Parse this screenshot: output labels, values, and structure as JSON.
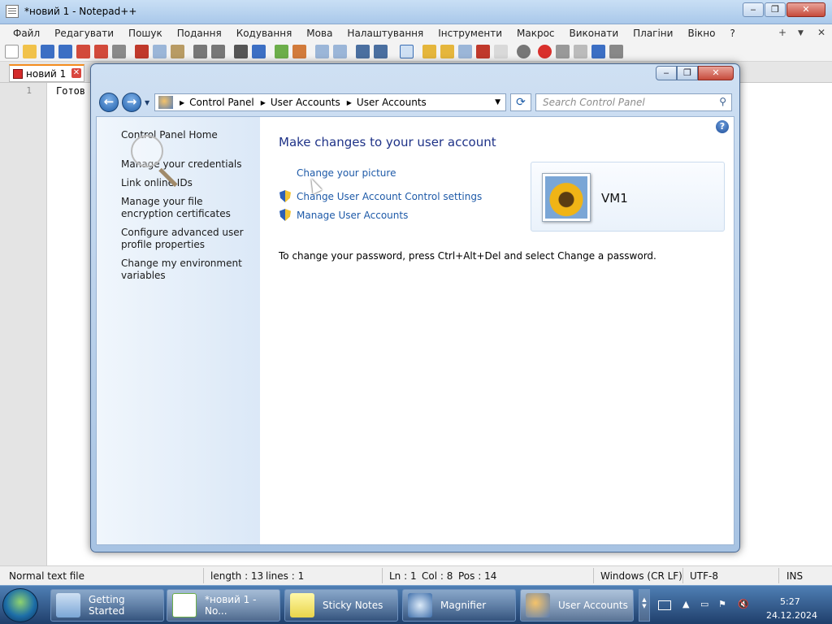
{
  "npp": {
    "title": "*новий 1 - Notepad++",
    "menu": [
      "Файл",
      "Редагувати",
      "Пошук",
      "Подання",
      "Кодування",
      "Мова",
      "Налаштування",
      "Інструменти",
      "Макрос",
      "Виконати",
      "Плагіни",
      "Вікно",
      "?"
    ],
    "menu_right": [
      "+",
      "▼",
      "✕"
    ],
    "tab_label": "новий 1",
    "line_number": "1",
    "editor_text": "Готов",
    "status": {
      "file_type": "Normal text file",
      "length": "length : 13",
      "lines": "lines : 1",
      "ln": "Ln : 1",
      "col": "Col : 8",
      "pos": "Pos : 14",
      "eol": "Windows (CR LF)",
      "encoding": "UTF-8",
      "mode": "INS"
    }
  },
  "cp": {
    "breadcrumb": [
      "Control Panel",
      "User Accounts",
      "User Accounts"
    ],
    "search_placeholder": "Search Control Panel",
    "left_links": [
      "Control Panel Home",
      "Manage your credentials",
      "Link online IDs",
      "Manage your file encryption certificates",
      "Configure advanced user profile properties",
      "Change my environment variables"
    ],
    "heading": "Make changes to your user account",
    "links": [
      "Change your picture",
      "Change User Account Control settings",
      "Manage User Accounts"
    ],
    "password_note": "To change your password, press Ctrl+Alt+Del and select Change a password.",
    "username": "VM1"
  },
  "taskbar": {
    "items": [
      "Getting Started",
      "*новий 1 - No...",
      "Sticky Notes",
      "Magnifier",
      "User Accounts"
    ],
    "time": "5:27",
    "date": "24.12.2024"
  },
  "colors": {
    "link": "#1e5aa8",
    "heading": "#1e3287",
    "taskbar": "#1f3f6b"
  }
}
